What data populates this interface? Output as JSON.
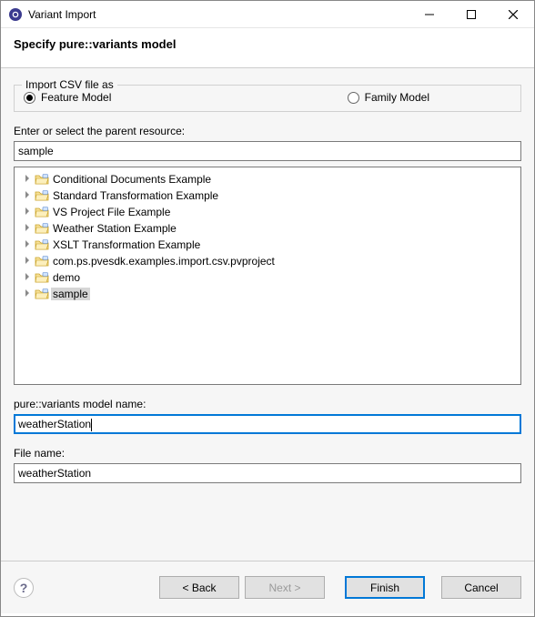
{
  "window": {
    "title": "Variant Import"
  },
  "header": {
    "title": "Specify pure::variants model"
  },
  "import_group": {
    "legend": "Import CSV file as",
    "feature_label": "Feature Model",
    "family_label": "Family Model",
    "selected": "feature"
  },
  "parent_resource": {
    "label": "Enter or select the parent resource:",
    "value": "sample"
  },
  "tree": {
    "items": [
      {
        "label": "Conditional Documents Example",
        "selected": false
      },
      {
        "label": "Standard Transformation Example",
        "selected": false
      },
      {
        "label": "VS Project File Example",
        "selected": false
      },
      {
        "label": "Weather Station Example",
        "selected": false
      },
      {
        "label": "XSLT Transformation Example",
        "selected": false
      },
      {
        "label": "com.ps.pvesdk.examples.import.csv.pvproject",
        "selected": false
      },
      {
        "label": "demo",
        "selected": false
      },
      {
        "label": "sample",
        "selected": true
      }
    ]
  },
  "model_name": {
    "label": "pure::variants model name:",
    "value": "weatherStation"
  },
  "file_name": {
    "label": "File name:",
    "value": "weatherStation"
  },
  "buttons": {
    "back": "< Back",
    "next": "Next >",
    "finish": "Finish",
    "cancel": "Cancel"
  }
}
